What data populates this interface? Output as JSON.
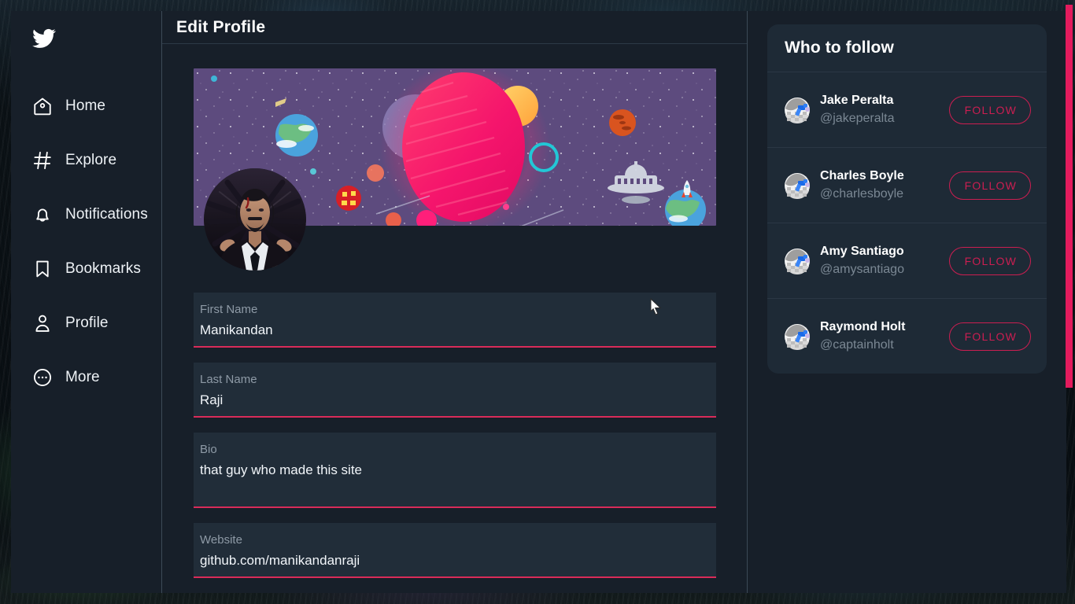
{
  "app": {
    "brand_icon": "twitter-bird-icon"
  },
  "sidebar": {
    "items": [
      {
        "label": "Home",
        "icon": "home-icon"
      },
      {
        "label": "Explore",
        "icon": "hashtag-icon"
      },
      {
        "label": "Notifications",
        "icon": "bell-icon"
      },
      {
        "label": "Bookmarks",
        "icon": "bookmark-icon"
      },
      {
        "label": "Profile",
        "icon": "person-icon"
      },
      {
        "label": "More",
        "icon": "ellipsis-circle-icon"
      }
    ]
  },
  "main": {
    "header_title": "Edit Profile",
    "banner_alt": "space-banner-image",
    "avatar_alt": "profile-avatar-image",
    "fields": [
      {
        "label": "First Name",
        "value": "Manikandan",
        "name": "first-name"
      },
      {
        "label": "Last Name",
        "value": "Raji",
        "name": "last-name"
      },
      {
        "label": "Bio",
        "value": "that guy who made this site",
        "name": "bio"
      },
      {
        "label": "Website",
        "value": "github.com/manikandanraji",
        "name": "website"
      }
    ]
  },
  "who_to_follow": {
    "title": "Who to follow",
    "follow_label": "FOLLOW",
    "people": [
      {
        "name": "Jake Peralta",
        "handle": "@jakeperalta"
      },
      {
        "name": "Charles Boyle",
        "handle": "@charlesboyle"
      },
      {
        "name": "Amy Santiago",
        "handle": "@amysantiago"
      },
      {
        "name": "Raymond Holt",
        "handle": "@captainholt"
      }
    ]
  },
  "colors": {
    "accent_pink": "#e31b5d",
    "follow_border": "#cc1e51",
    "panel_bg": "#171f29",
    "card_bg": "#1e2a36",
    "field_bg": "#212d39",
    "field_underline": "#d92b59",
    "muted_text": "#7b8894"
  }
}
